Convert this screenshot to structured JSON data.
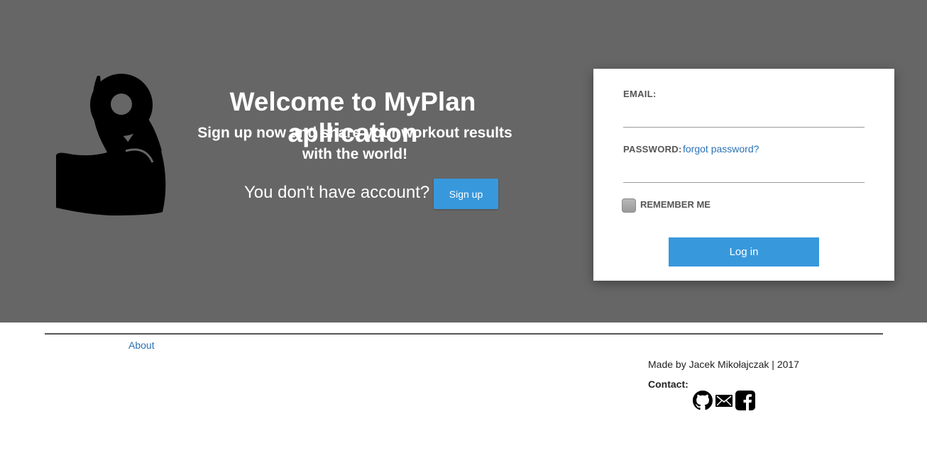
{
  "hero": {
    "title": "Welcome to MyPlan apllication",
    "subtitle": "Sign up now and share your workout results with the world!",
    "signup_prompt": "You don't have account?",
    "signup_button": "Sign up",
    "background_color": "#666666",
    "logo_icon": "flexed-arm-dumbbell-icon"
  },
  "login": {
    "email_label": "EMAIL:",
    "email_value": "",
    "password_label": "PASSWORD:",
    "password_value": "",
    "forgot_link": "forgot password?",
    "remember_label": "REMEMBER ME",
    "remember_checked": false,
    "login_button": "Log in",
    "accent_color": "#3898dc"
  },
  "footer": {
    "about_link": "About",
    "credit": "Made by Jacek Mikołajczak | 2017",
    "contact_label": "Contact:",
    "contact_icons": [
      "github-icon",
      "mail-icon",
      "facebook-icon"
    ]
  }
}
